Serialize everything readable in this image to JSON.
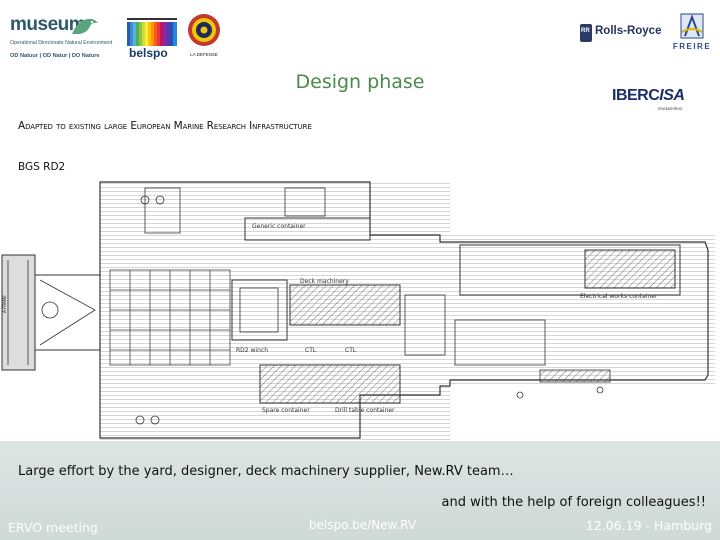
{
  "logos": {
    "museum": {
      "wordmark": "museum",
      "line1": "Operational Directorate Natural Environment",
      "line2": "OD Natuur | OD Natur | DO Nature"
    },
    "belspo": {
      "wordmark": "belspo"
    },
    "seal": {
      "caption": "LA DEFENSE"
    },
    "rolls_royce": {
      "wordmark": "Rolls-Royce"
    },
    "freire": {
      "wordmark": "FREIRE"
    },
    "iberisa": {
      "wordmark_a": "IBERC",
      "wordmark_b": "ISA",
      "tagline": "ENGINEERING"
    }
  },
  "slide": {
    "title": "Design phase",
    "subtitle": "Adapted to existing large European Marine Research Infrastructure",
    "drawing_label": "BGS RD2"
  },
  "drawing": {
    "labels": {
      "container_top": "Generic container",
      "elec_container": "Electrical works container",
      "deck_machinery": "Deck machinery",
      "sorting_table": "Drill table container",
      "spare_container": "Spare container",
      "lift_label": "RD2 winch",
      "ctl_a": "CTL",
      "ctl_b": "CTL",
      "frame_label": "A-FRAME"
    }
  },
  "captions": {
    "effort": "Large effort by the yard, designer, deck machinery supplier, New.RV team…",
    "help": "and with the help of foreign colleagues!!"
  },
  "footer": {
    "event": "ERVO meeting",
    "url": "belspo.be/New.RV",
    "date_place": "12.06.19 -  Hamburg"
  },
  "colors": {
    "title_green": "#4a8a4a",
    "band": "#d6dfdc",
    "footer_text": "#ffffff"
  }
}
